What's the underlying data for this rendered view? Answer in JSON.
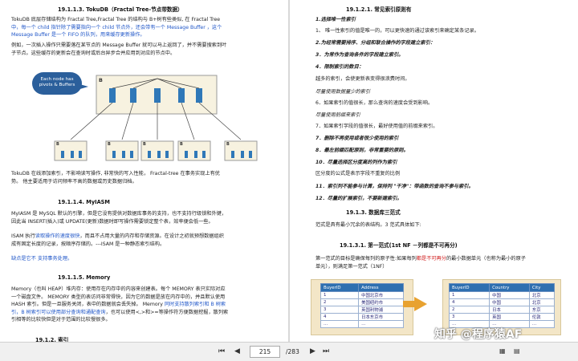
{
  "left": {
    "h1": "19.1.1.3.   TokuDB（Fractal Tree-节点带数据）",
    "p1_l1": "TokuDB 底层存储结构为 Fractal Tree,Fractal Tree 的结构与 B+树有些类似, 在 Fractal Tree",
    "p1_l2a": "中，每一个 child 指针除了需要指向一个 child 节点外，还会带有一个 Message Buffer ，这个",
    "p1_l3": "Message Buffer 是一个 FIFO 的队列，用来缓存更新操作。",
    "p2_l1": "例如，一次插入操作只需要落在某节点的 Message Buffer 就可以马上返回了，并不需要搜索到叶",
    "p2_l2": "子节点。这些缓存的更新会在查询时或后台异步合并应用到对应的节点中。",
    "bubble_l1": "Each node has",
    "bubble_l2": "pivots & Buffers",
    "node_label": "B",
    "p3_l1": "TokuDB 在线添加索引，不影响读写操作, 非常快的写入性能，  Fractal-tree 在事务实现上有优",
    "p3_l2": "势。 他主要适用于访问频率不高的数据或历史数据归档。",
    "h2": "19.1.1.4.    MyIASM",
    "p4_l1": "MyIASM 是 MySQL 默认的引擎，但是它没有提供对数据库事务的支持，也不支持行级锁和外键，",
    "p4_l2": "因此当 INSERT(插入)或 UPDATE(更新)数据时即写操作需要锁定整个表，效率便会低一些。",
    "p5_l1a": "ISAM 执行",
    "p5_l1b": "读取操作的速度很快",
    "p5_l1c": "，而且不占用大量的内存和存储资源。在设计之初就预想数据组织",
    "p5_l2": "成有固定长度的记录，按顺序存储的。---ISAM 是一种静态索引结构。",
    "p6": "缺点是它不 支持事务处理。",
    "h3": "19.1.1.5.    Memory",
    "p7_l1": "Memory（也叫 HEAP）堆内存：使用存在内存中的内容来创建表。每个 MEMORY 表只实际对应",
    "p7_l2": "一个磁盘文件。 MEMORY 类型的表访问非常得快，因为它的数据是放在内存中的，并且默认使用",
    "p7_l3a": "HASH 索引。但是一旦服务关闭，表中的数据就会丢失掉。 Memory ",
    "p7_l3b": "同时支持散列索引和 B 树索",
    "p7_l4a": "引，B 树索引可以使用部分查询和通配查询",
    "p7_l4b": "，也可以使用<,>和>=等操作符方便数据挖掘，散列索",
    "p7_l5": "引相等的比较快但是对于范围的比较慢很多。",
    "h4": "19.1.2.    索引"
  },
  "right": {
    "h1": "19.1.2.1.     常见索引原则有",
    "r1": "1.选择唯一性索引",
    "r2": "1、 唯一性索引的值是唯一的，可以更快速的通过该索引来确定某条记录。",
    "r3": "2.为经常需要排序、分组和联合操作的字段建立索引：",
    "r4": "3．为常作为查询条件的字段建立索引。",
    "r5": "4．限制索引的数目：",
    "r6": "越多的索引，会使更新表变得很浪费时间。",
    "r7": "尽量使用数据量少的索引",
    "r8": "6．如果索引的值很长，那么查询的速度会受到影响。",
    "r9": "尽量使用前缀来索引",
    "r10": "7．如果索引字段的值很长，最好使用值的前缀来索引。",
    "r11": "7．删除不再使用或者很少使用的索引",
    "r12": "8．最左前缀匹配原则，非常重要的原则。",
    "r13": "10．尽量选择区分度高的列作为索引",
    "r14": "区分度的公式是表示字段不重复的比例",
    "r15": "11．索引列不能参与计算，保持列 \"干净\"：带函数的查询不参与索引。",
    "r16": "12．尽量的扩展索引，不要新建索引。",
    "h2": "19.1.3.     数据库三范式",
    "r17": "范式是具有最小冗余的表结构。3 范式具体如下:",
    "h3": "19.1.3.1.   第一范式(1st NF －列都是不可再分)",
    "r18a": "第一范式的目标是确保每列的原子性:如果每列",
    "r18b": "都是不可再分",
    "r18c": "的最小数据单元（也称为最小的原子",
    "r19": "单元），则满足第一范式（1NF）",
    "table1": {
      "headers": [
        "BuyerID",
        "Address"
      ],
      "rows": [
        [
          "1",
          "中国北京市"
        ],
        [
          "2",
          "美国纽约市"
        ],
        [
          "3",
          "英国利物浦"
        ],
        [
          "4",
          "日本东京市"
        ],
        [
          "…",
          "…"
        ]
      ]
    },
    "table2": {
      "headers": [
        "BuyerID",
        "Country",
        "City"
      ],
      "rows": [
        [
          "1",
          "中国",
          "北京"
        ],
        [
          "4",
          "中国",
          "北京"
        ],
        [
          "2",
          "日本",
          "东京"
        ],
        [
          "3",
          "英国",
          "伦敦"
        ],
        [
          "…",
          "…",
          "…"
        ]
      ]
    }
  },
  "toolbar": {
    "first": "⏮",
    "prev": "◀",
    "current_page": "215",
    "total": "/283",
    "next": "▶",
    "last": "⏭"
  },
  "watermark": "知乎 @程序猿AF"
}
